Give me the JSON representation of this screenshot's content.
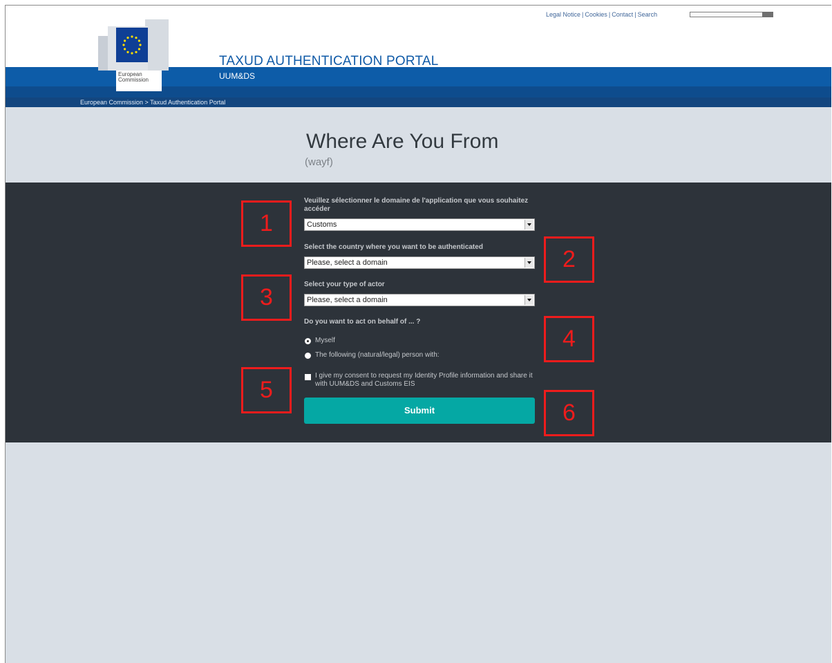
{
  "header": {
    "top_links": [
      "Legal Notice",
      "Cookies",
      "Contact",
      "Search"
    ],
    "portal_title": "TAXUD AUTHENTICATION PORTAL",
    "portal_subtitle": "UUM&DS",
    "logo_caption": [
      "European",
      "Commission"
    ],
    "breadcrumb": "European Commission > Taxud Authentication Portal"
  },
  "page": {
    "heading": "Where Are You From",
    "subheading": "(wayf)"
  },
  "form": {
    "domain_label": "Veuillez sélectionner le domaine de l'application que vous souhaitez accéder",
    "domain_value": "Customs",
    "country_label": "Select the country where you want to be authenticated",
    "country_value": "Please, select a domain",
    "actor_label": "Select your type of actor",
    "actor_value": "Please, select a domain",
    "behalf_label": "Do you want to act on behalf of ... ?",
    "option_myself": "Myself",
    "option_other": "The following (natural/legal) person with:",
    "consent_text": "I give my consent to request my Identity Profile information and share it with UUM&DS and Customs EIS",
    "submit_label": "Submit"
  },
  "annotations": [
    "1",
    "2",
    "3",
    "4",
    "5",
    "6"
  ],
  "colors": {
    "marker": "#ee1c1c",
    "submit": "#05a8a4",
    "panel": "#2d333a",
    "header_blue": "#0d5ca8"
  }
}
